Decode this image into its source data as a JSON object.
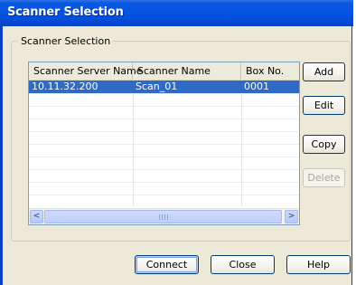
{
  "window": {
    "title": "Scanner Selection"
  },
  "group": {
    "label": "Scanner Selection"
  },
  "list": {
    "columns": [
      "Scanner Server Name",
      "Scanner Name",
      "Box No."
    ],
    "rows": [
      {
        "server": "10.11.32.200",
        "scanner": "Scan_01",
        "box": "0001",
        "selected": true
      }
    ],
    "scroll": {
      "left_arrow": "<",
      "right_arrow": ">"
    }
  },
  "side_buttons": {
    "add": "Add",
    "edit": "Edit",
    "copy": "Copy",
    "delete": "Delete"
  },
  "bottom_buttons": {
    "connect": "Connect",
    "close": "Close",
    "help": "Help"
  },
  "colors": {
    "title_bar": "#0554e2",
    "selection": "#316ac5",
    "dialog_background": "#ece9d8"
  }
}
